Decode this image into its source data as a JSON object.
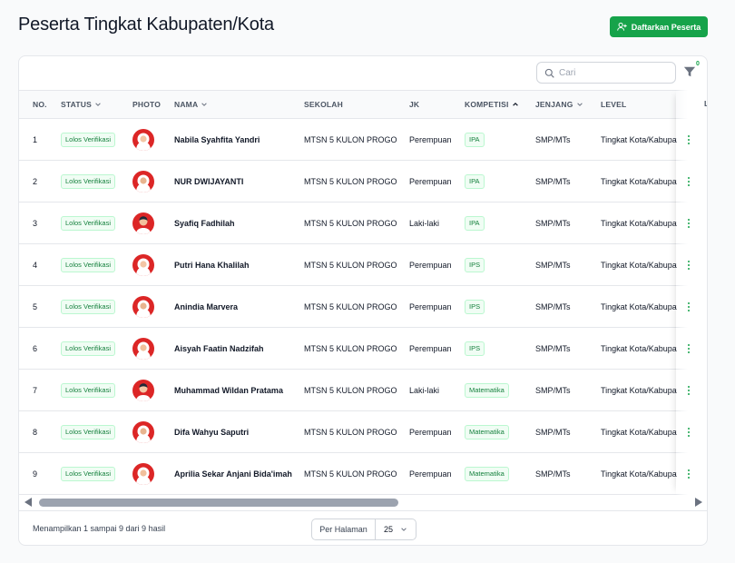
{
  "page": {
    "title": "Peserta Tingkat Kabupaten/Kota"
  },
  "actions": {
    "register_label": "Daftarkan Peserta"
  },
  "toolbar": {
    "search_placeholder": "Cari",
    "filter_count": "0"
  },
  "table": {
    "columns": {
      "no": "NO.",
      "status": "STATUS",
      "photo": "PHOTO",
      "nama": "NAMA",
      "sekolah": "SEKOLAH",
      "jk": "JK",
      "kompetisi": "KOMPETISI",
      "jenjang": "JENJANG",
      "level": "LEVEL",
      "last": "L"
    },
    "rows": [
      {
        "no": "1",
        "status": "Lolos Verifikasi",
        "nama": "Nabila Syahfita Yandri",
        "sekolah": "MTSN 5 KULON PROGO",
        "jk": "Perempuan",
        "kompetisi": "IPA",
        "jenjang": "SMP/MTs",
        "level": "Tingkat Kota/Kabupaten"
      },
      {
        "no": "2",
        "status": "Lolos Verifikasi",
        "nama": "NUR DWIJAYANTI",
        "sekolah": "MTSN 5 KULON PROGO",
        "jk": "Perempuan",
        "kompetisi": "IPA",
        "jenjang": "SMP/MTs",
        "level": "Tingkat Kota/Kabupaten"
      },
      {
        "no": "3",
        "status": "Lolos Verifikasi",
        "nama": "Syafiq Fadhilah",
        "sekolah": "MTSN 5 KULON PROGO",
        "jk": "Laki-laki",
        "kompetisi": "IPA",
        "jenjang": "SMP/MTs",
        "level": "Tingkat Kota/Kabupaten"
      },
      {
        "no": "4",
        "status": "Lolos Verifikasi",
        "nama": "Putri Hana Khalilah",
        "sekolah": "MTSN 5 KULON PROGO",
        "jk": "Perempuan",
        "kompetisi": "IPS",
        "jenjang": "SMP/MTs",
        "level": "Tingkat Kota/Kabupaten"
      },
      {
        "no": "5",
        "status": "Lolos Verifikasi",
        "nama": "Anindia Marvera",
        "sekolah": "MTSN 5 KULON PROGO",
        "jk": "Perempuan",
        "kompetisi": "IPS",
        "jenjang": "SMP/MTs",
        "level": "Tingkat Kota/Kabupaten"
      },
      {
        "no": "6",
        "status": "Lolos Verifikasi",
        "nama": "Aisyah Faatin Nadzifah",
        "sekolah": "MTSN 5 KULON PROGO",
        "jk": "Perempuan",
        "kompetisi": "IPS",
        "jenjang": "SMP/MTs",
        "level": "Tingkat Kota/Kabupaten"
      },
      {
        "no": "7",
        "status": "Lolos Verifikasi",
        "nama": "Muhammad Wildan Pratama",
        "sekolah": "MTSN 5 KULON PROGO",
        "jk": "Laki-laki",
        "kompetisi": "Matematika",
        "jenjang": "SMP/MTs",
        "level": "Tingkat Kota/Kabupaten"
      },
      {
        "no": "8",
        "status": "Lolos Verifikasi",
        "nama": "Difa Wahyu Saputri",
        "sekolah": "MTSN 5 KULON PROGO",
        "jk": "Perempuan",
        "kompetisi": "Matematika",
        "jenjang": "SMP/MTs",
        "level": "Tingkat Kota/Kabupaten"
      },
      {
        "no": "9",
        "status": "Lolos Verifikasi",
        "nama": "Aprilia Sekar Anjani Bida'imah",
        "sekolah": "MTSN 5 KULON PROGO",
        "jk": "Perempuan",
        "kompetisi": "Matematika",
        "jenjang": "SMP/MTs",
        "level": "Tingkat Kota/Kabupaten"
      }
    ]
  },
  "footer": {
    "summary": "Menampilkan 1 sampai 9 dari 9 hasil",
    "per_page_label": "Per Halaman",
    "per_page_value": "25"
  },
  "colors": {
    "accent": "#16a34a",
    "badge_text": "#15803d",
    "border": "#e5e7eb"
  },
  "icons": {
    "register": "user-plus-icon",
    "search": "search-icon",
    "filter": "filter-icon",
    "row_menu": "more-vertical-icon"
  }
}
